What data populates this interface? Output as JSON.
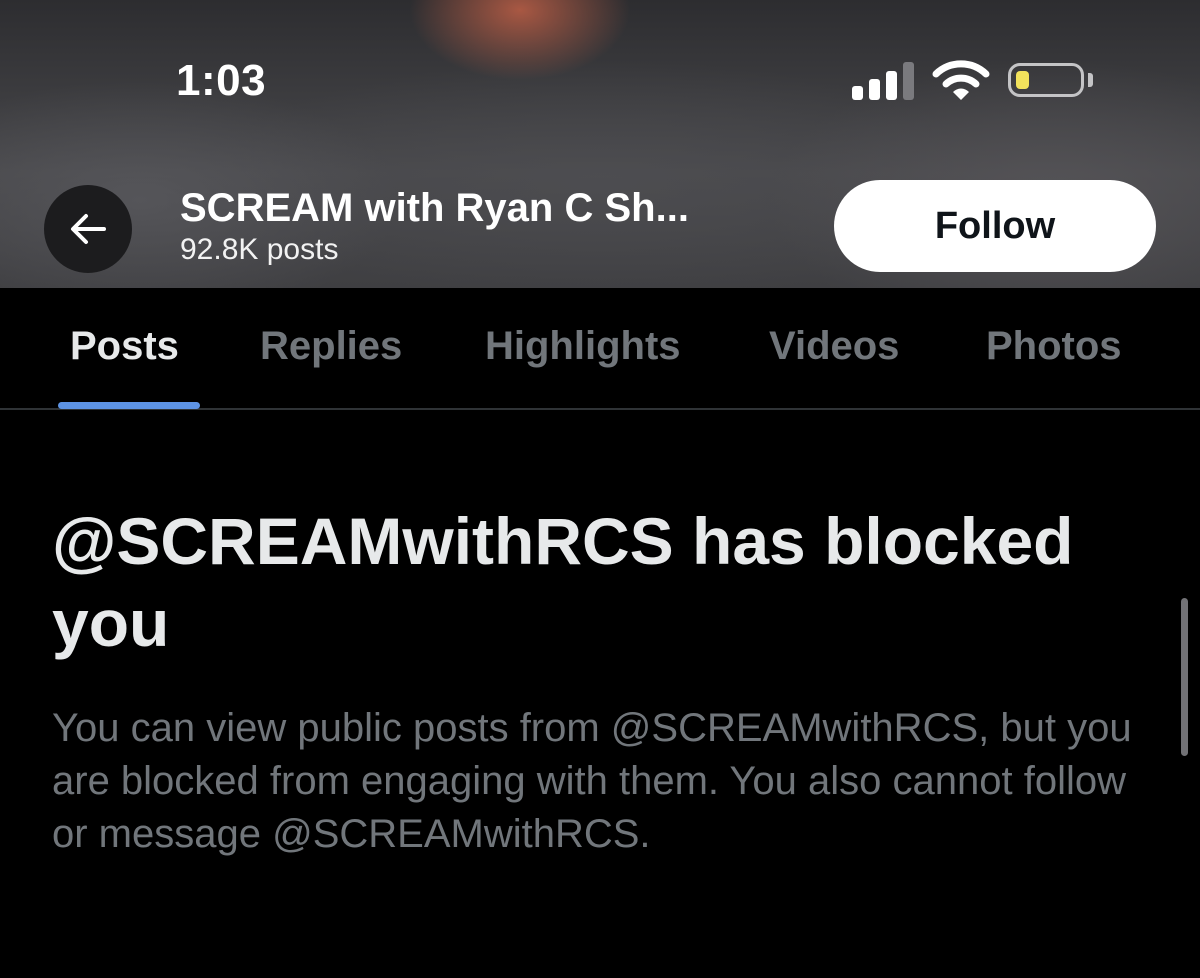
{
  "status_bar": {
    "time": "1:03",
    "icons": [
      "cellular-signal-icon",
      "wifi-icon",
      "battery-icon"
    ]
  },
  "header": {
    "back_icon": "arrow-left-icon",
    "display_name": "SCREAM with Ryan C Sh...",
    "post_count": "92.8K posts",
    "follow_label": "Follow"
  },
  "tabs": [
    {
      "label": "Posts",
      "active": true
    },
    {
      "label": "Replies",
      "active": false
    },
    {
      "label": "Highlights",
      "active": false
    },
    {
      "label": "Videos",
      "active": false
    },
    {
      "label": "Photos",
      "active": false
    }
  ],
  "blocked": {
    "title": "@SCREAMwithRCS has blocked you",
    "description": "You can view public posts from @SCREAMwithRCS, but you are blocked from engaging with them. You also cannot follow or message @SCREAMwithRCS."
  },
  "colors": {
    "background": "#000000",
    "tab_indicator": "#5d93e4",
    "primary_text": "#e7e9ea",
    "secondary_text": "#71767b",
    "battery_low": "#f2e25c"
  }
}
